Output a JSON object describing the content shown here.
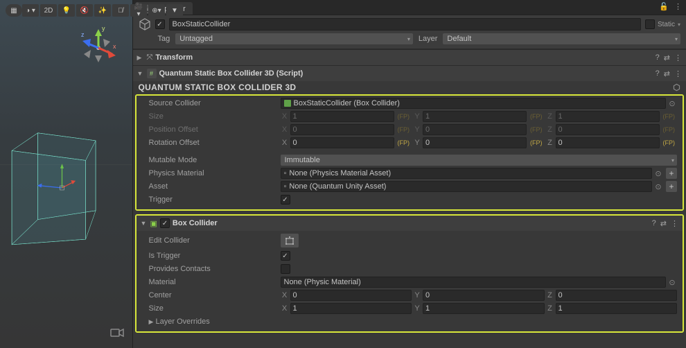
{
  "scene_toolbar": {
    "btn_2d": "2D",
    "dropdown_glyph": "⬤▾",
    "light_icon": "light-icon",
    "audio_icon": "audio-icon",
    "fx_icon": "fx-icon",
    "hidden_icon": "hidden-icon",
    "camera_icon": "camera-icon",
    "gizmos_icon": "gizmos-icon"
  },
  "orientation": {
    "x": "x",
    "y": "y",
    "z": "z"
  },
  "inspector": {
    "tab_label": "Inspector",
    "lock_glyph": "🔓",
    "more_glyph": "⋮"
  },
  "gameobject": {
    "name": "BoxStaticCollider",
    "active": true,
    "static_label": "Static",
    "static_dropdown_glyph": "▾",
    "tag_label": "Tag",
    "tag_value": "Untagged",
    "layer_label": "Layer",
    "layer_value": "Default"
  },
  "transform": {
    "title": "Transform"
  },
  "quantum": {
    "script_title": "Quantum Static Box Collider 3D (Script)",
    "header": "QUANTUM STATIC BOX COLLIDER 3D",
    "source_collider": {
      "label": "Source Collider",
      "value": "BoxStaticCollider (Box Collider)"
    },
    "size": {
      "label": "Size",
      "x": "1",
      "y": "1",
      "z": "1"
    },
    "position_offset": {
      "label": "Position Offset",
      "x": "0",
      "y": "0",
      "z": "0"
    },
    "rotation_offset": {
      "label": "Rotation Offset",
      "x": "0",
      "y": "0",
      "z": "0"
    },
    "mutable_mode": {
      "label": "Mutable Mode",
      "value": "Immutable"
    },
    "physics_material": {
      "label": "Physics Material",
      "value": "None (Physics Material Asset)"
    },
    "asset": {
      "label": "Asset",
      "value": "None (Quantum Unity Asset)"
    },
    "trigger": {
      "label": "Trigger",
      "checked": true
    },
    "fp_tag": "(FP)"
  },
  "box_collider": {
    "title": "Box Collider",
    "edit_collider": {
      "label": "Edit Collider"
    },
    "is_trigger": {
      "label": "Is Trigger",
      "checked": true
    },
    "provides_contacts": {
      "label": "Provides Contacts",
      "checked": false
    },
    "material": {
      "label": "Material",
      "value": "None (Physic Material)"
    },
    "center": {
      "label": "Center",
      "x": "0",
      "y": "0",
      "z": "0"
    },
    "size": {
      "label": "Size",
      "x": "1",
      "y": "1",
      "z": "1"
    },
    "layer_overrides": {
      "label": "Layer Overrides"
    }
  },
  "axis_labels": {
    "x": "X",
    "y": "Y",
    "z": "Z"
  }
}
